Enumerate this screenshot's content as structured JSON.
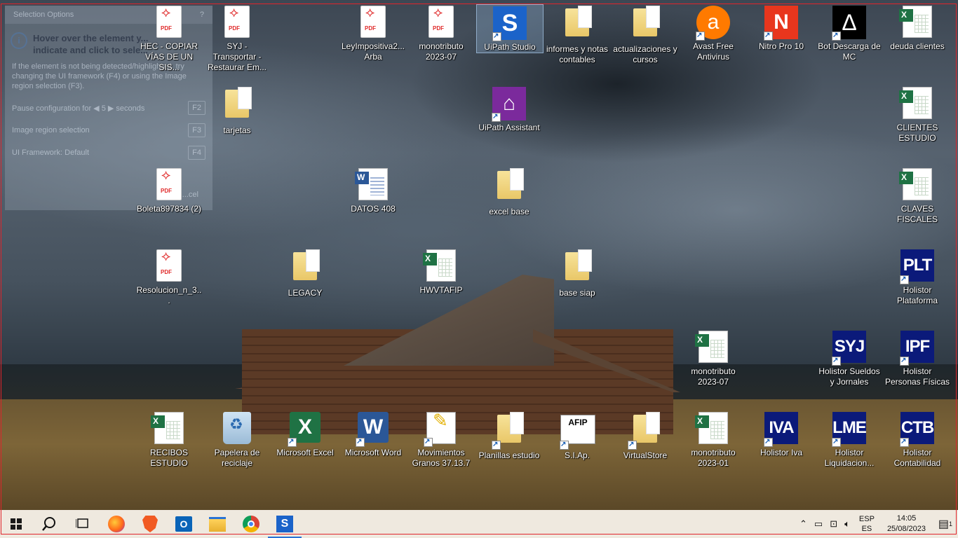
{
  "selection_panel": {
    "title": "Selection Options",
    "help": "?",
    "hover_text": "Hover over the element you want to indicate and click to select it",
    "hover_text_visible": "Hover over the element y...",
    "hover_text_visible2": "indicate and click to sele...",
    "desc": "If the element is not being detected/highlighted, try changing the UI framework (F4) or using the Image region selection (F3).",
    "row1": "Pause configuration for ◀ 5 ▶ seconds",
    "row1_key": "F2",
    "row2": "Image region selection",
    "row2_key": "F3",
    "row3": "UI Framework: Default",
    "row3_key": "F4",
    "cancel": "...cel"
  },
  "icons": [
    {
      "label": "HEC - COPIAR VÍAS DE UN SIS...",
      "type": "pdf"
    },
    {
      "label": "SYJ - Transportar - Restaurar Em...",
      "type": "pdf"
    },
    {
      "label": "LeyImpositiva2... Arba",
      "type": "pdf"
    },
    {
      "label": "monotributo 2023-07",
      "type": "pdf"
    },
    {
      "label": "UiPath Studio",
      "type": "uipath"
    },
    {
      "label": "informes y notas contables",
      "type": "folder"
    },
    {
      "label": "actualizaciones y cursos",
      "type": "folder"
    },
    {
      "label": "Avast Free Antivirus",
      "type": "avast"
    },
    {
      "label": "Nitro Pro 10",
      "type": "nitro"
    },
    {
      "label": "Bot Descarga de MC",
      "type": "botmc"
    },
    {
      "label": "deuda clientes",
      "type": "excel"
    },
    {
      "label": "tarjetas",
      "type": "folder"
    },
    {
      "label": "UiPath Assistant",
      "type": "uiassist"
    },
    {
      "label": "CLIENTES ESTUDIO",
      "type": "excel"
    },
    {
      "label": "Boleta897834 (2)",
      "type": "pdf"
    },
    {
      "label": "DATOS 408",
      "type": "word"
    },
    {
      "label": "excel base",
      "type": "folder"
    },
    {
      "label": "CLAVES FISCALES",
      "type": "excel"
    },
    {
      "label": "Resolucion_n_3...",
      "type": "pdf"
    },
    {
      "label": "LEGACY",
      "type": "folder"
    },
    {
      "label": "HWVTAFIP",
      "type": "excel"
    },
    {
      "label": "base siap",
      "type": "folder"
    },
    {
      "label": "Holistor Plataforma",
      "type": "holistor",
      "abbr": "PLT"
    },
    {
      "label": "monotributo 2023-07",
      "type": "excel"
    },
    {
      "label": "Holistor Sueldos y Jornales",
      "type": "holistor",
      "abbr": "SYJ"
    },
    {
      "label": "Holistor Personas Físicas",
      "type": "holistor",
      "abbr": "IPF"
    },
    {
      "label": "RECIBOS ESTUDIO",
      "type": "excel"
    },
    {
      "label": "Papelera de reciclaje",
      "type": "recycle"
    },
    {
      "label": "Microsoft Excel",
      "type": "excelapp"
    },
    {
      "label": "Microsoft Word",
      "type": "wordapp"
    },
    {
      "label": "Movimientos Granos 37.13.7",
      "type": "mov"
    },
    {
      "label": "Planillas estudio",
      "type": "folder"
    },
    {
      "label": "S.I.Ap.",
      "type": "siap",
      "abbr": "AFIP"
    },
    {
      "label": "VirtualStore",
      "type": "folder"
    },
    {
      "label": "monotributo 2023-01",
      "type": "excel"
    },
    {
      "label": "Holistor Iva",
      "type": "holistor",
      "abbr": "IVA"
    },
    {
      "label": "Holistor Liquidacion...",
      "type": "holistor",
      "abbr": "LME"
    },
    {
      "label": "Holistor Contabilidad",
      "type": "holistor",
      "abbr": "CTB"
    }
  ],
  "taskbar": {
    "apps": [
      "start",
      "search",
      "task-view",
      "firefox",
      "brave",
      "outlook",
      "file-explorer",
      "chrome",
      "uipath"
    ],
    "lang_top": "ESP",
    "lang_bottom": "ES",
    "time": "14:05",
    "date": "25/08/2023",
    "notif_count": "1"
  },
  "colors": {
    "accent": "#2a74d6",
    "border_highlight": "#e0242b",
    "holistor_blue": "#0b1a7a"
  }
}
